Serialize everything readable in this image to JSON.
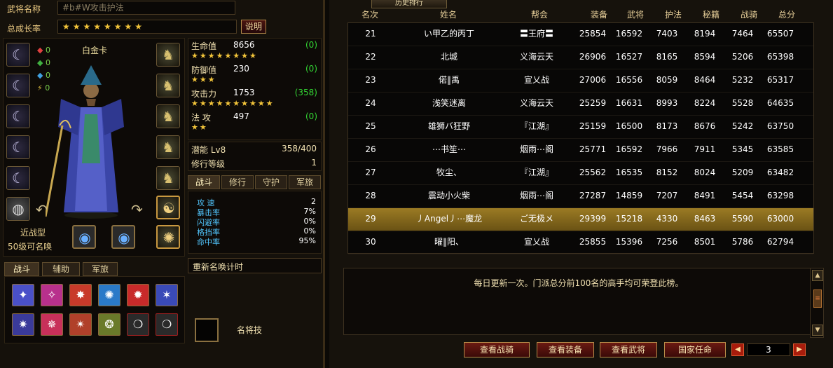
{
  "left": {
    "name_label": "武将名称",
    "name_value": "#b#W攻击护法",
    "growth_label": "总成长率",
    "growth_stars": "★★★★★★★★",
    "explain_btn": "说明",
    "hero_name": "白金卡",
    "hero_type": "近战型",
    "hero_level_note": "50级可名唤",
    "mini_stats": [
      "0",
      "0",
      "0",
      "0"
    ],
    "stats": [
      {
        "label": "生命值",
        "value": "8656",
        "bonus": "(0)",
        "stars": "★★★★★★★★"
      },
      {
        "label": "防御值",
        "value": "230",
        "bonus": "(0)",
        "stars": "★★★"
      },
      {
        "label": "攻击力",
        "value": "1753",
        "bonus": "(358)",
        "stars": "★★★★★★★★★★"
      },
      {
        "label": "法  攻",
        "value": "497",
        "bonus": "(0)",
        "stars": "★★"
      }
    ],
    "potential_label": "潜能 Lv8",
    "potential_value": "358/400",
    "cultivation_label": "修行等级",
    "cultivation_value": "1",
    "tabs": [
      "战斗",
      "修行",
      "守护",
      "军旅"
    ],
    "combat_stats": [
      {
        "label": "攻  速",
        "value": "2"
      },
      {
        "label": "暴击率",
        "value": "7%"
      },
      {
        "label": "闪避率",
        "value": "0%"
      },
      {
        "label": "格挡率",
        "value": "0%"
      },
      {
        "label": "命中率",
        "value": "95%"
      }
    ],
    "renew_label": "重新名唤计时",
    "skill_tabs": [
      "战斗",
      "辅助",
      "军旅"
    ],
    "famous_skill_label": "名将技"
  },
  "right": {
    "tab_title": "历史排行",
    "headers": [
      "名次",
      "姓名",
      "帮会",
      "装备",
      "武将",
      "护法",
      "秘籍",
      "战骑",
      "总分"
    ],
    "rows": [
      {
        "rank": "21",
        "name": "い甲乙的丙丁",
        "guild": "〓王府〓",
        "equip": "25854",
        "general": "16592",
        "guard": "7403",
        "book": "8194",
        "mount": "7464",
        "total": "65507"
      },
      {
        "rank": "22",
        "name": "北城",
        "guild": "义海云天",
        "equip": "26906",
        "general": "16527",
        "guard": "8165",
        "book": "8594",
        "mount": "5206",
        "total": "65398"
      },
      {
        "rank": "23",
        "name": "偌‖禹",
        "guild": "宣乂战",
        "equip": "27006",
        "general": "16556",
        "guard": "8059",
        "book": "8464",
        "mount": "5232",
        "total": "65317"
      },
      {
        "rank": "24",
        "name": "浅笑迷离",
        "guild": "义海云天",
        "equip": "25259",
        "general": "16631",
        "guard": "8993",
        "book": "8224",
        "mount": "5528",
        "total": "64635"
      },
      {
        "rank": "25",
        "name": "雄狮バ狂野",
        "guild": "『江湖』",
        "equip": "25159",
        "general": "16500",
        "guard": "8173",
        "book": "8676",
        "mount": "5242",
        "total": "63750"
      },
      {
        "rank": "26",
        "name": "⋯书笙⋯",
        "guild": "烟雨⋯阁",
        "equip": "25771",
        "general": "16592",
        "guard": "7966",
        "book": "7911",
        "mount": "5345",
        "total": "63585"
      },
      {
        "rank": "27",
        "name": "牧尘、",
        "guild": "『江湖』",
        "equip": "25562",
        "general": "16535",
        "guard": "8152",
        "book": "8024",
        "mount": "5209",
        "total": "63482"
      },
      {
        "rank": "28",
        "name": "震动小火柴",
        "guild": "烟雨⋯阁",
        "equip": "27287",
        "general": "14859",
        "guard": "7207",
        "book": "8491",
        "mount": "5454",
        "total": "63298"
      },
      {
        "rank": "29",
        "name": "丿Angel丿⋯魔龙",
        "guild": "ご无极メ",
        "equip": "29399",
        "general": "15218",
        "guard": "4330",
        "book": "8463",
        "mount": "5590",
        "total": "63000"
      },
      {
        "rank": "30",
        "name": "曜‖阳、",
        "guild": "宣乂战",
        "equip": "25855",
        "general": "15396",
        "guard": "7256",
        "book": "8501",
        "mount": "5786",
        "total": "62794"
      }
    ],
    "highlight_rank": "29",
    "info_text": "每日更新一次。门派总分前100名的高手均可荣登此榜。",
    "buttons": [
      "查看战骑",
      "查看装备",
      "查看武将",
      "国家任命"
    ],
    "page": "3",
    "colors": {
      "highlight": "#9b7b24",
      "bonus_green": "#33d633",
      "stars": "#f2c43a",
      "combat_label": "#52c7ff"
    }
  }
}
